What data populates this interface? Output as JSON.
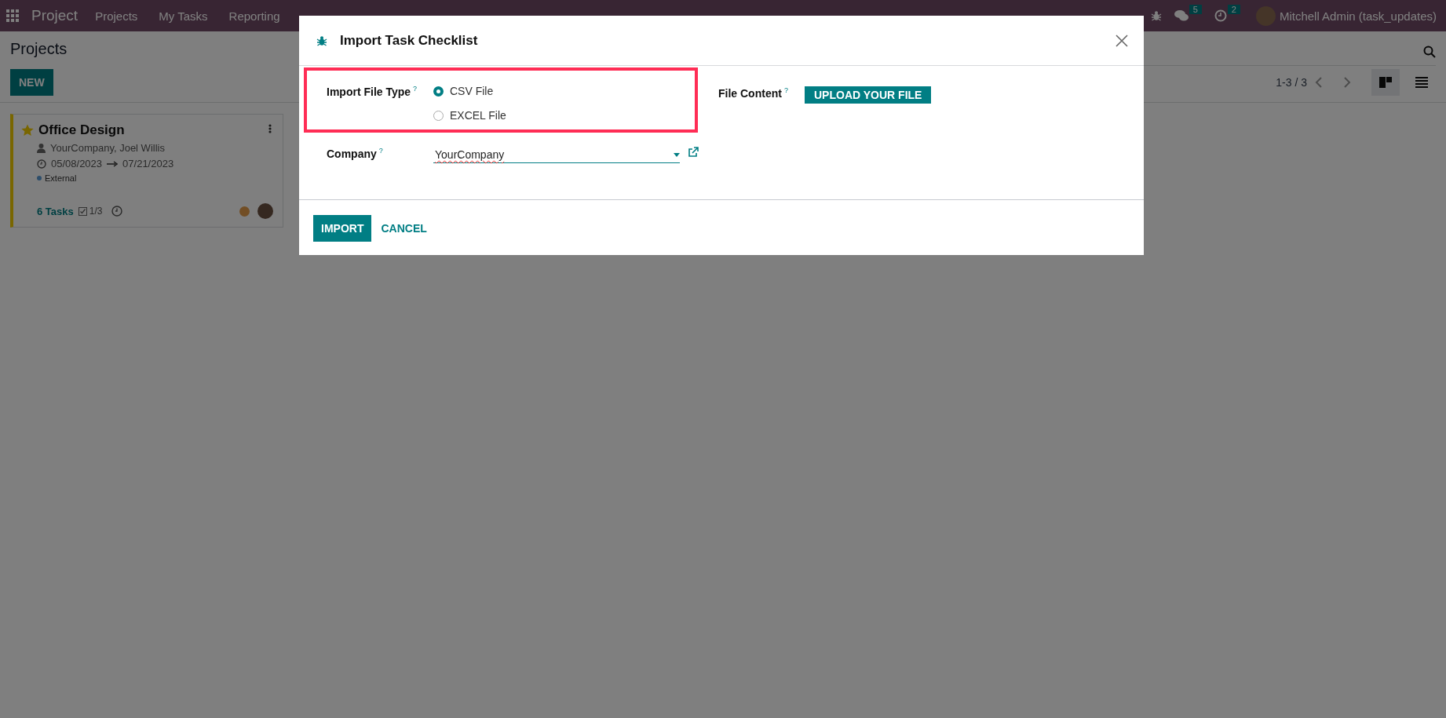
{
  "navbar": {
    "app_name": "Project",
    "menu": [
      "Projects",
      "My Tasks",
      "Reporting"
    ],
    "messages_count": "5",
    "activities_count": "2",
    "user": "Mitchell Admin (task_updates)"
  },
  "control_panel": {
    "breadcrumb": "Projects",
    "new_button": "NEW",
    "pager": "1-3 / 3",
    "views": [
      {
        "kind": "kanban",
        "selected": true
      },
      {
        "kind": "list",
        "selected": false
      }
    ]
  },
  "project_card": {
    "name": "Office Design",
    "favorite": true,
    "customer": "YourCompany, Joel Willis",
    "date_start": "05/08/2023",
    "date_end": "07/21/2023",
    "tags": [
      "External"
    ],
    "tasks": "6 Tasks",
    "checklist": "1/3"
  },
  "dialog": {
    "title": "Import Task Checklist",
    "import_file_type": {
      "label": "Import File Type",
      "help": "?",
      "highlighted": true,
      "options": [
        {
          "label": "CSV File",
          "selected": true
        },
        {
          "label": "EXCEL File",
          "selected": false
        }
      ]
    },
    "file_content": {
      "label": "File Content",
      "help": "?",
      "button": "UPLOAD YOUR FILE"
    },
    "company": {
      "label": "Company",
      "help": "?",
      "value": "YourCompany"
    },
    "buttons": [
      {
        "label": "IMPORT",
        "kind": "primary"
      },
      {
        "label": "CANCEL",
        "kind": "link"
      }
    ]
  }
}
